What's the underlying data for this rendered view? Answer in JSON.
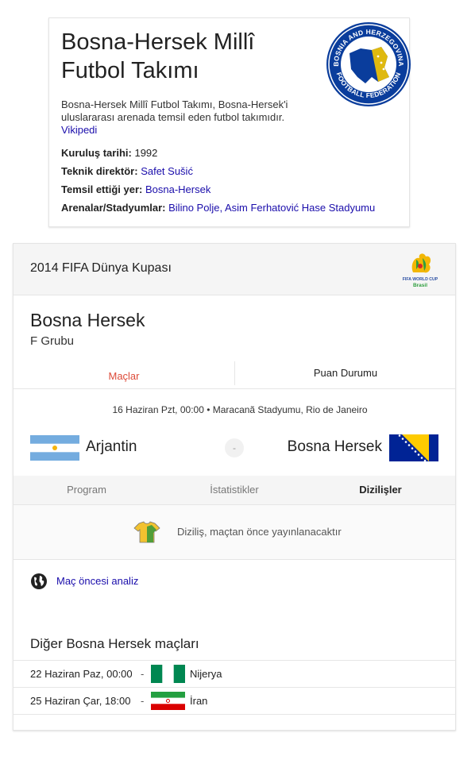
{
  "knowledge_panel": {
    "title": "Bosna-Hersek Millî Futbol Takımı",
    "logo_text": "BOSNIA AND HERZEGOVINA FOOTBALL FEDERATION",
    "description": "Bosna-Hersek Millî Futbol Takımı, Bosna-Hersek'i uluslararası arenada temsil eden futbol takımıdır.",
    "source": "Vikipedi",
    "facts": [
      {
        "label": "Kuruluş tarihi:",
        "value": "1992",
        "is_link": false
      },
      {
        "label": "Teknik direktör:",
        "value": "Safet Sušić",
        "is_link": true
      },
      {
        "label": "Temsil ettiği yer:",
        "value": "Bosna-Hersek",
        "is_link": true
      },
      {
        "label": "Arenalar/Stadyumlar:",
        "value": "Bilino Polje, Asim Ferhatović Hase Stadyumu",
        "is_link": true
      }
    ]
  },
  "tournament_card": {
    "title": "2014 FIFA Dünya Kupası",
    "logo_text": "FIFA WORLD CUP",
    "logo_subtext": "Brasil",
    "team": "Bosna Hersek",
    "group": "F Grubu",
    "tabs": [
      {
        "label": "Maçlar",
        "active": true
      },
      {
        "label": "Puan Durumu",
        "active": false
      }
    ],
    "match": {
      "info": "16 Haziran Pzt, 00:00 • Maracanã Stadyumu, Rio de Janeiro",
      "home": "Arjantin",
      "away": "Bosna Hersek",
      "score_placeholder": "-"
    },
    "subtabs": [
      {
        "label": "Program",
        "active": false
      },
      {
        "label": "İstatistikler",
        "active": false
      },
      {
        "label": "Dizilişler",
        "active": true
      }
    ],
    "lineup_message": "Diziliş, maçtan önce yayınlanacaktır",
    "analysis_link": "Maç öncesi analiz",
    "other_matches_title": "Diğer Bosna Hersek maçları",
    "other_matches": [
      {
        "date": "22 Haziran Paz, 00:00",
        "dash": "-",
        "opponent": "Nijerya",
        "flag_icon": "nigeria-flag-icon"
      },
      {
        "date": "25 Haziran Çar, 18:00",
        "dash": "-",
        "opponent": "İran",
        "flag_icon": "iran-flag-icon"
      }
    ]
  },
  "colors": {
    "link": "#1a0dab",
    "active_tab": "#dd4b39",
    "bosnia_blue": "#002395",
    "bosnia_yellow": "#fecb00",
    "argentina_blue": "#74acdf"
  }
}
